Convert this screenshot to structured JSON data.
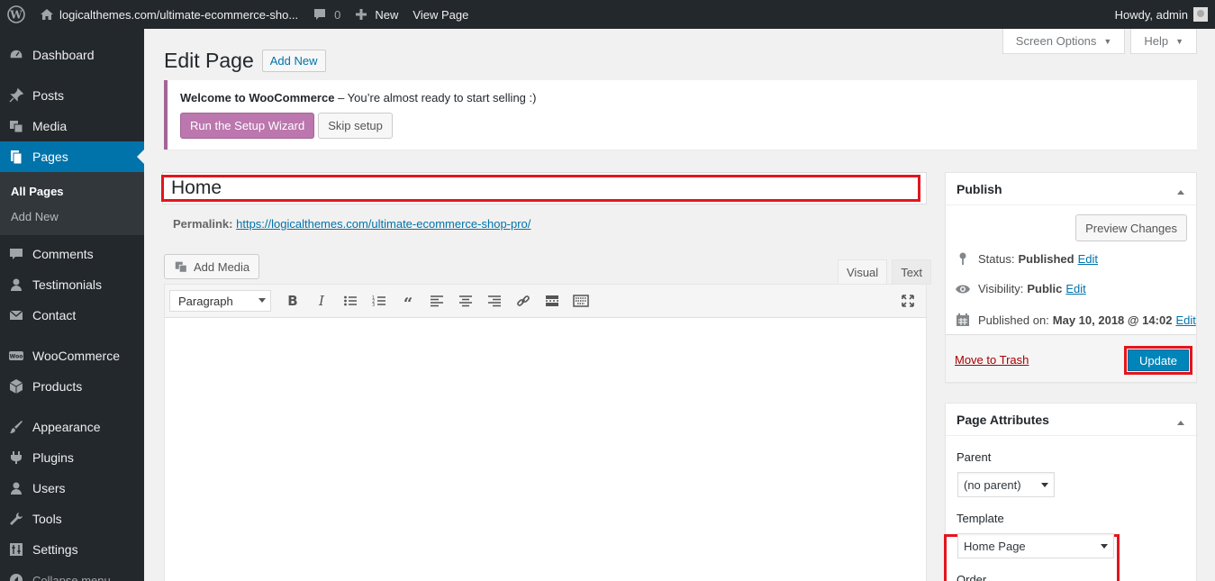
{
  "adminbar": {
    "site_name": "logicalthemes.com/ultimate-ecommerce-sho...",
    "comments_count": "0",
    "new_label": "New",
    "view_page_label": "View Page",
    "greeting": "Howdy, admin"
  },
  "sidebar": {
    "items": [
      {
        "label": "Dashboard",
        "icon": "dashboard-icon"
      },
      {
        "label": "Posts",
        "icon": "pin-icon"
      },
      {
        "label": "Media",
        "icon": "media-icon"
      },
      {
        "label": "Pages",
        "icon": "pages-icon"
      },
      {
        "label": "Comments",
        "icon": "comment-icon"
      },
      {
        "label": "Testimonials",
        "icon": "users-icon"
      },
      {
        "label": "Contact",
        "icon": "email-icon"
      },
      {
        "label": "WooCommerce",
        "icon": "woo-icon"
      },
      {
        "label": "Products",
        "icon": "archive-icon"
      },
      {
        "label": "Appearance",
        "icon": "brush-icon"
      },
      {
        "label": "Plugins",
        "icon": "plugin-icon"
      },
      {
        "label": "Users",
        "icon": "user-icon"
      },
      {
        "label": "Tools",
        "icon": "wrench-icon"
      },
      {
        "label": "Settings",
        "icon": "settings-icon"
      },
      {
        "label": "Collapse menu",
        "icon": "collapse-icon"
      }
    ],
    "submenu": {
      "all_pages": "All Pages",
      "add_new": "Add New"
    }
  },
  "screen_meta": {
    "screen_options": "Screen Options",
    "help": "Help"
  },
  "header": {
    "title": "Edit Page",
    "add_new": "Add New"
  },
  "notice": {
    "bold": "Welcome to WooCommerce",
    "text": " – You’re almost ready to start selling :)",
    "run_wizard": "Run the Setup Wizard",
    "skip": "Skip setup"
  },
  "post": {
    "title": "Home",
    "permalink_label": "Permalink:",
    "permalink_url": "https://logicalthemes.com/ultimate-ecommerce-shop-pro/"
  },
  "editor": {
    "add_media": "Add Media",
    "tab_visual": "Visual",
    "tab_text": "Text",
    "format": "Paragraph"
  },
  "publish": {
    "heading": "Publish",
    "preview": "Preview Changes",
    "status_label": "Status:",
    "status_value": "Published",
    "visibility_label": "Visibility:",
    "visibility_value": "Public",
    "published_label": "Published on:",
    "published_value": "May 10, 2018 @ 14:02",
    "edit": "Edit",
    "trash": "Move to Trash",
    "update": "Update"
  },
  "attributes": {
    "heading": "Page Attributes",
    "parent_label": "Parent",
    "parent_value": "(no parent)",
    "template_label": "Template",
    "template_value": "Home Page",
    "order_label": "Order"
  },
  "colors": {
    "admin_bar": "#23282d",
    "accent": "#0073aa",
    "highlight_box": "#e2161d",
    "woo_purple": "#bb77ae"
  }
}
